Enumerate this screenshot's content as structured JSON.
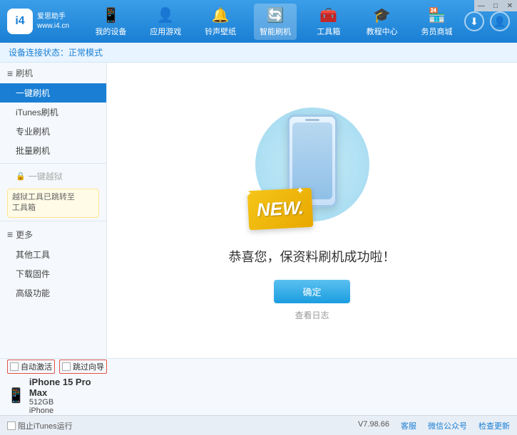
{
  "app": {
    "logo_text": "爱思助手",
    "logo_subtext": "www.i4.cn",
    "logo_letter": "i4"
  },
  "nav": {
    "items": [
      {
        "id": "my-device",
        "icon": "📱",
        "label": "我的设备"
      },
      {
        "id": "app-games",
        "icon": "👤",
        "label": "应用游戏"
      },
      {
        "id": "ringtones",
        "icon": "🔔",
        "label": "铃声壁纸"
      },
      {
        "id": "smart-flash",
        "icon": "🔄",
        "label": "智能刷机",
        "active": true
      },
      {
        "id": "toolbox",
        "icon": "🧰",
        "label": "工具箱"
      },
      {
        "id": "tutorial",
        "icon": "🎓",
        "label": "教程中心"
      },
      {
        "id": "merchant",
        "icon": "🏪",
        "label": "务员商城"
      }
    ]
  },
  "breadcrumb": {
    "prefix": "设备连接状态：",
    "status": "正常模式"
  },
  "sidebar": {
    "section_flash": "刷机",
    "items": [
      {
        "id": "onekey-flash",
        "label": "一键刷机",
        "active": true
      },
      {
        "id": "itunes-flash",
        "label": "iTunes刷机"
      },
      {
        "id": "pro-flash",
        "label": "专业刷机"
      },
      {
        "id": "batch-flash",
        "label": "批量刷机"
      }
    ],
    "section_onekey_status": "一键越狱",
    "notice": "越狱工具已跳转至\n工具箱",
    "section_more": "更多",
    "more_items": [
      {
        "id": "other-tools",
        "label": "其他工具"
      },
      {
        "id": "download-firmware",
        "label": "下载固件"
      },
      {
        "id": "advanced",
        "label": "高级功能"
      }
    ]
  },
  "content": {
    "new_badge": "NEW.",
    "success_message": "恭喜您，保资料刷机成功啦！",
    "confirm_button": "确定",
    "view_log": "查看日志"
  },
  "device_bar": {
    "auto_activate_label": "自动激活",
    "time_guide_label": "跳过向导",
    "device_name": "iPhone 15 Pro Max",
    "device_storage": "512GB",
    "device_type": "iPhone"
  },
  "status_bar": {
    "stop_itunes_label": "阻止iTunes运行",
    "version": "V7.98.66",
    "links": [
      "客服",
      "微信公众号",
      "检查更新"
    ]
  },
  "window_controls": {
    "minimize": "—",
    "maximize": "□",
    "close": "✕"
  }
}
